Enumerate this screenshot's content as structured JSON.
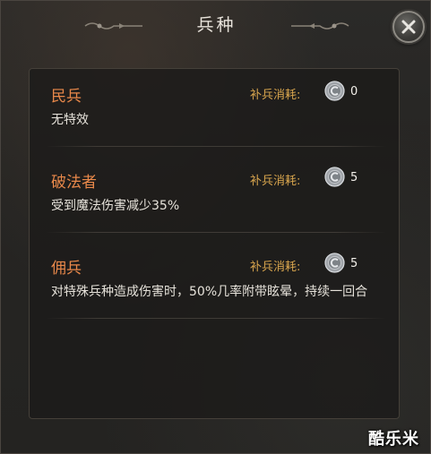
{
  "window": {
    "title": "兵种"
  },
  "cost_label": "补兵消耗:",
  "units": [
    {
      "name": "民兵",
      "description": "无特效",
      "cost": "0"
    },
    {
      "name": "破法者",
      "description": "受到魔法伤害减少35%",
      "cost": "5"
    },
    {
      "name": "佣兵",
      "description": "对特殊兵种造成伤害时，50%几率附带眩晕，持续一回合",
      "cost": "5"
    }
  ],
  "icons": {
    "close": "close-icon",
    "coin": "silver-coin-icon"
  },
  "colors": {
    "unit_name": "#e8884a",
    "cost_label": "#d9a64e",
    "text": "#e6e2da"
  },
  "watermark": "酷乐米"
}
